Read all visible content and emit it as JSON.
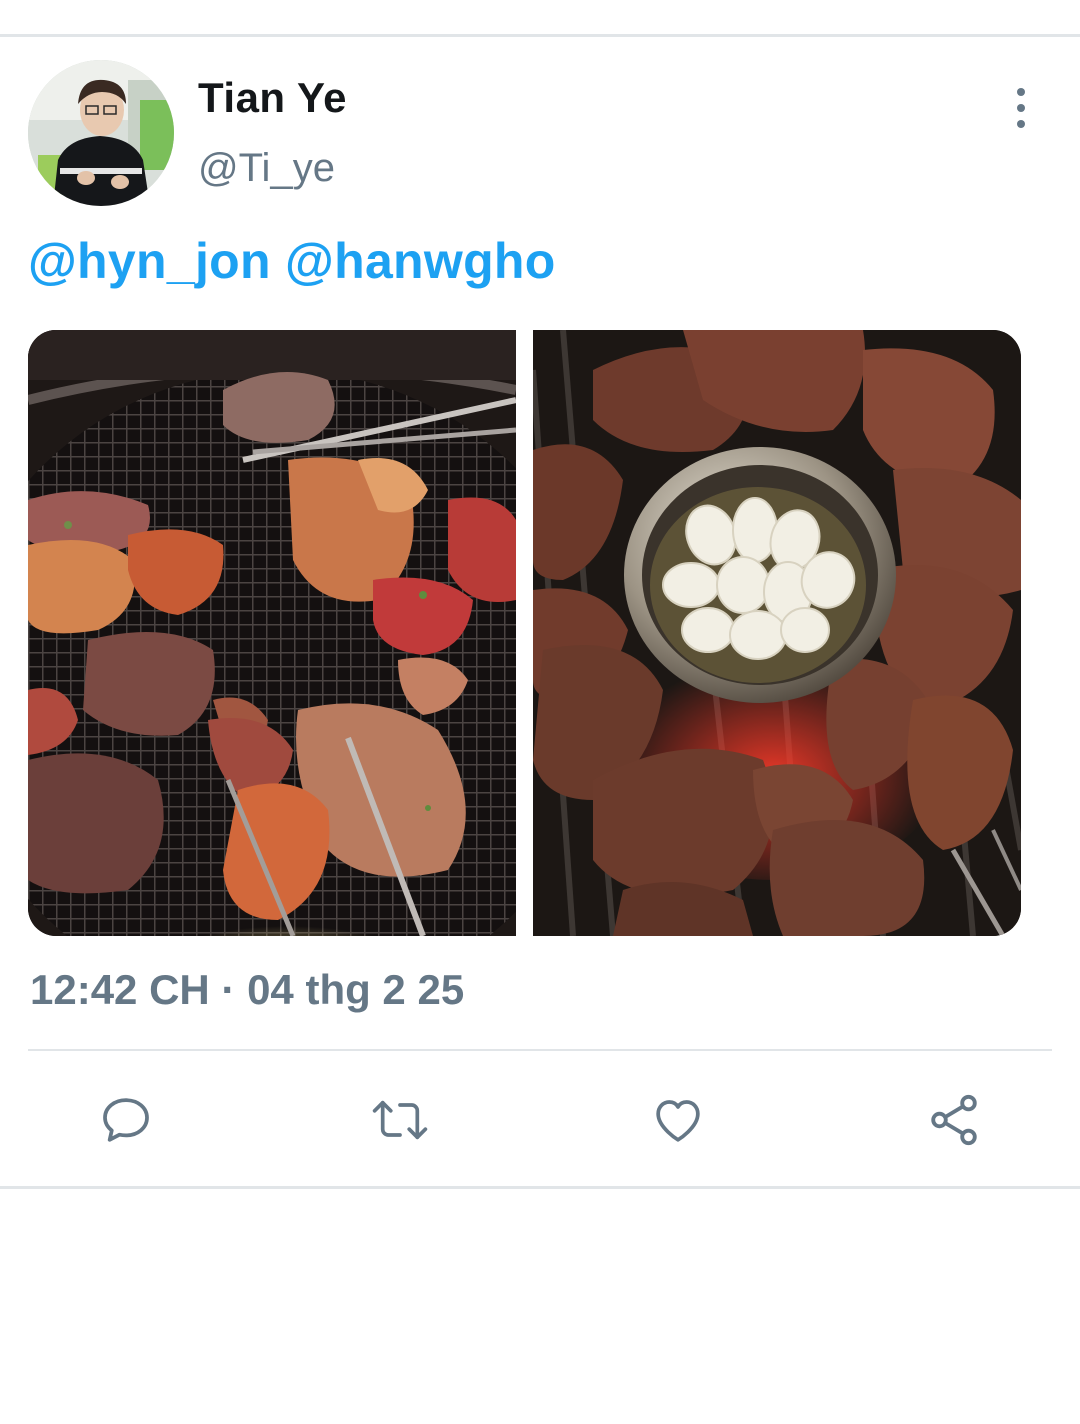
{
  "tweet": {
    "author": {
      "display_name": "Tian Ye",
      "handle": "@Ti_ye"
    },
    "text": {
      "mention_1": "@hyn_jon",
      "mention_2": "@hanwgho"
    },
    "timestamp": "12:42 CH · 04 thg 2 25"
  },
  "actions": [
    {
      "icon": "reply-icon"
    },
    {
      "icon": "retweet-icon"
    },
    {
      "icon": "like-icon"
    },
    {
      "icon": "share-icon"
    }
  ],
  "colors": {
    "link": "#1da1f2",
    "secondary_text": "#657786",
    "primary_text": "#14171a",
    "divider": "#e1e5e8"
  }
}
